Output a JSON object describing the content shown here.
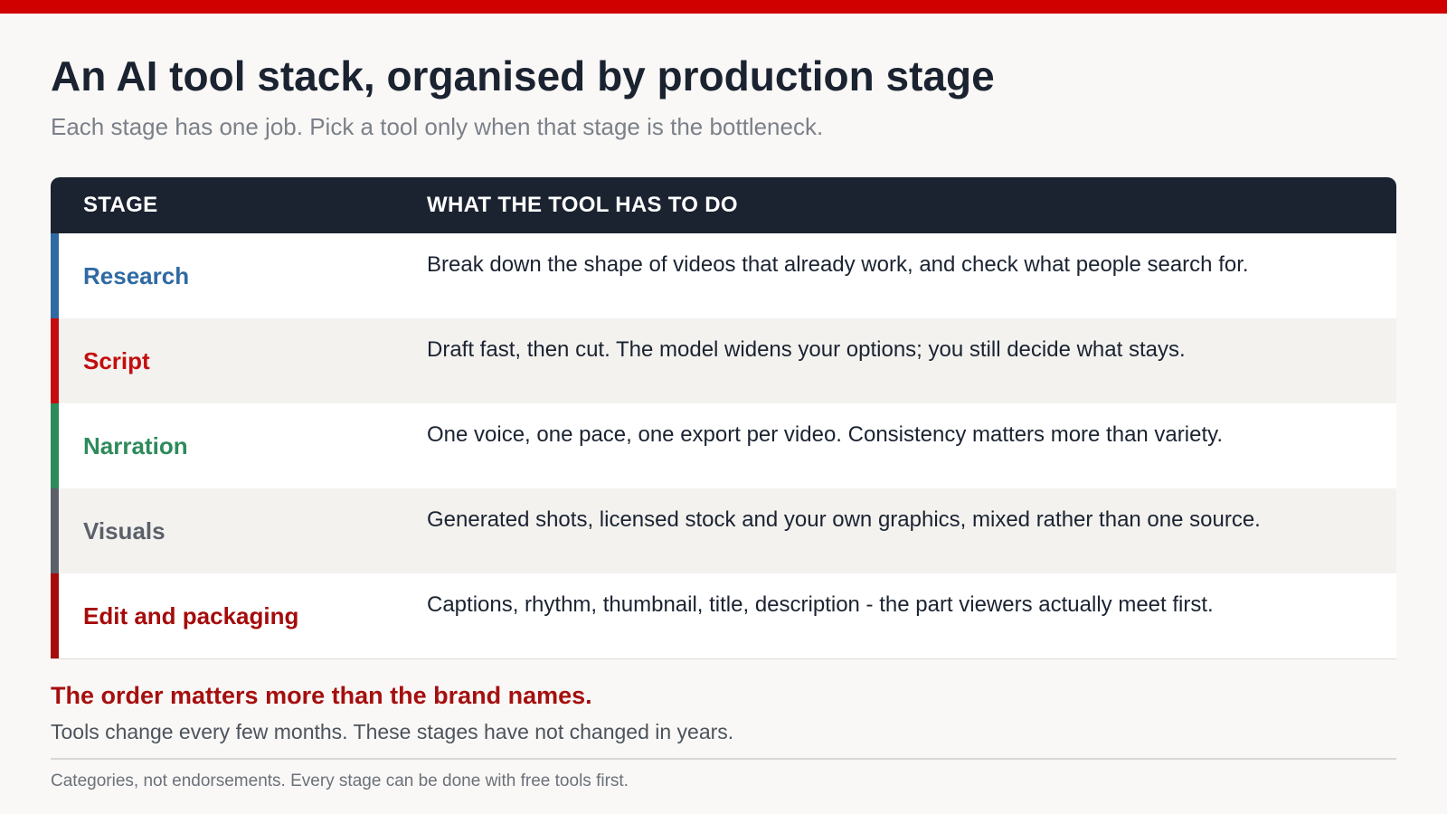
{
  "page": {
    "title": "An AI tool stack, organised by production stage",
    "subtitle": "Each stage has one job. Pick a tool only when that stage is the bottleneck."
  },
  "table": {
    "headers": {
      "stage": "STAGE",
      "description": "WHAT THE TOOL HAS TO DO"
    },
    "rows": [
      {
        "stage": "Research",
        "description": "Break down the shape of videos that already work, and check what people search for.",
        "color": "#2f6aa3"
      },
      {
        "stage": "Script",
        "description": "Draft fast, then cut. The model widens your options; you still decide what stays.",
        "color": "#c40d0d"
      },
      {
        "stage": "Narration",
        "description": "One voice, one pace, one export per video. Consistency matters more than variety.",
        "color": "#2e8a5c"
      },
      {
        "stage": "Visuals",
        "description": "Generated shots, licensed stock and your own graphics, mixed rather than one source.",
        "color": "#5b6069"
      },
      {
        "stage": "Edit and packaging",
        "description": "Captions, rhythm, thumbnail, title, description - the part viewers actually meet first.",
        "color": "#a60b0b"
      }
    ]
  },
  "callout": {
    "title": "The order matters more than the brand names.",
    "text": "Tools change every few months. These stages have not changed in years."
  },
  "footnote": "Categories, not endorsements. Every stage can be done with free tools first.",
  "colors": {
    "accent": "#d10000",
    "header_bg": "#1b2331",
    "callout_title": "#a50f0f"
  }
}
